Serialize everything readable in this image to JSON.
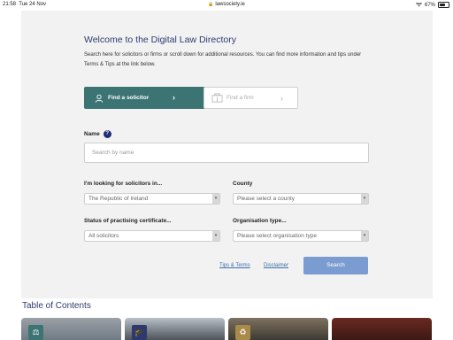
{
  "status_bar": {
    "time": "21:58",
    "date": "Tue 24 Nov",
    "url": "lawsociety.ie",
    "battery": "67%",
    "battery_level": 0.67
  },
  "header": {
    "title": "Welcome to the Digital Law Directory",
    "intro": "Search here for solicitors or firms or scroll down for additional resources. You can find more information and tips under Terms & Tips at the link below."
  },
  "tabs": {
    "solicitor_label": "Find a solicitor",
    "firm_label": "Find a firm"
  },
  "name": {
    "label": "Name",
    "help": "?",
    "placeholder": "Search by name"
  },
  "filters": {
    "location_label": "I'm looking for solicitors in...",
    "location_value": "The Republic of Ireland",
    "county_label": "County",
    "county_value": "Please select a county",
    "status_label": "Status of practising certificate...",
    "status_value": "All solicitors",
    "org_label": "Organisation type...",
    "org_value": "Please select organisation type"
  },
  "footer_links": {
    "tips": "Tips & Terms",
    "disclaimer": "Disclaimer",
    "search": "Search"
  },
  "toc": {
    "title": "Table of Contents"
  },
  "colors": {
    "accent": "#3c7474",
    "heading": "#2e3a6e",
    "search_button": "#7b9cd0"
  }
}
